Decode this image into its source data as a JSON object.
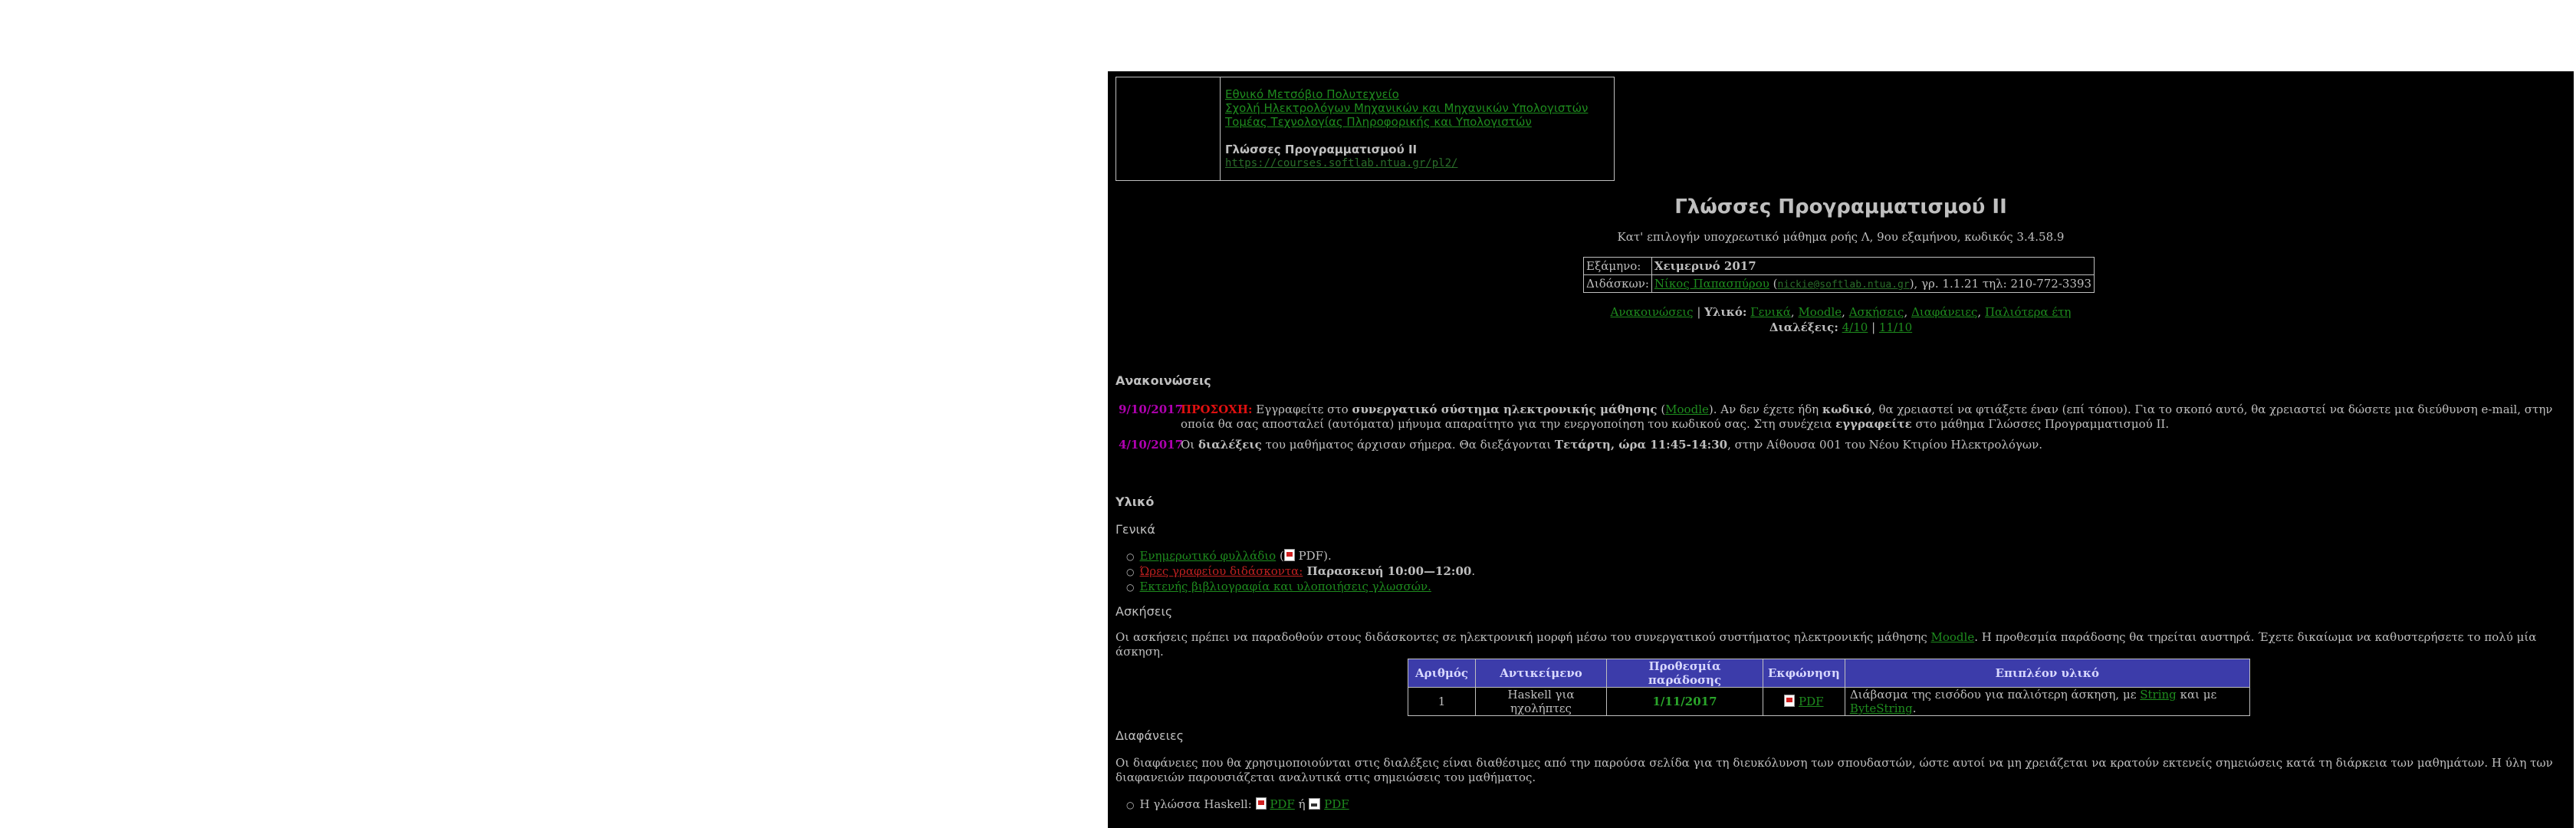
{
  "header": {
    "links": [
      "Εθνικό Μετσόβιο Πολυτεχνείο",
      "Σχολή Ηλεκτρολόγων Μηχανικών και Μηχανικών Υπολογιστών",
      "Τομέας Τεχνολογίας Πληροφορικής και Υπολογιστών"
    ],
    "course_name": "Γλώσσες Προγραμματισμού ΙΙ",
    "course_url": "https://courses.softlab.ntua.gr/pl2/"
  },
  "course": {
    "title": "Γλώσσες Προγραμματισμού ΙΙ",
    "subtitle": "Κατ' επιλογήν υποχρεωτικό μάθημα ροής Λ, 9ου εξαμήνου, κωδικός 3.4.58.9"
  },
  "info": {
    "semester_label": "Εξάμηνο:",
    "semester_value": "Χειμερινό 2017",
    "instructor_label": "Διδάσκων:",
    "instructor_name": "Νίκος Παπασπύρου",
    "instructor_email": "nickie@softlab.ntua.gr",
    "instructor_open": "(",
    "instructor_rest": "), γρ. 1.1.21 τηλ: 210-772-3393"
  },
  "nav": {
    "announcements": "Ανακοινώσεις",
    "sep": " | ",
    "material_label": "Υλικό:",
    "items": [
      "Γενικά",
      "Moodle",
      "Ασκήσεις",
      "Διαφάνειες",
      "Παλιότερα έτη"
    ],
    "lectures_label": "Διαλέξεις:",
    "lectures": [
      "4/10",
      "11/10"
    ],
    "pipe": " | "
  },
  "announcements": {
    "heading": "Ανακοινώσεις",
    "items": [
      {
        "date": "9/10/2017",
        "warn": "ΠΡΟΣΟΧΗ:",
        "t1": " Εγγραφείτε στο ",
        "b1": "συνεργατικό σύστημα ηλεκτρονικής μάθησης",
        "t2": " (",
        "link": "Moodle",
        "t3": "). Αν δεν έχετε ήδη ",
        "b2": "κωδικό",
        "t4": ", θα χρειαστεί να φτιάξετε έναν (επί τόπου). Για το σκοπό αυτό, θα χρειαστεί να δώσετε μια διεύθυνση e-mail, στην οποία θα σας αποσταλεί (αυτόματα) μήνυμα απαραίτητο για την ενεργοποίηση του κωδικού σας. Στη συνέχεια ",
        "b3": "εγγραφείτε",
        "t5": " στο μάθημα Γλώσσες Προγραμματισμού ΙΙ."
      },
      {
        "date": "4/10/2017",
        "t1": "Οι ",
        "b1": "διαλέξεις",
        "t2": " του μαθήματος άρχισαν σήμερα. Θα διεξάγονται ",
        "b2": "Τετάρτη, ώρα 11:45-14:30",
        "t3": ", στην Αίθουσα 001 του Νέου Κτιρίου Ηλεκτρολόγων."
      }
    ]
  },
  "material": {
    "heading": "Υλικό",
    "general_heading": "Γενικά",
    "general": {
      "info_link": "Ενημερωτικό φυλλάδιο",
      "info_open": " (",
      "info_pdf": " PDF).",
      "hours_link": "Ώρες γραφείου διδάσκοντα:",
      "hours_value": " Παρασκευή 10:00—12:00",
      "hours_end": ".",
      "biblio_link": "Εκτενής βιβλιογραφία και υλοποιήσεις γλωσσών."
    },
    "exercises_heading": "Ασκήσεις",
    "exercises_text": "Οι ασκήσεις πρέπει να παραδοθούν στους διδάσκοντες σε ηλεκτρονική μορφή μέσω του συνεργατικού συστήματος ηλεκτρονικής μάθησης ",
    "exercises_link": "Moodle",
    "exercises_text2": ". Η προθεσμία παράδοσης θα τηρείται αυστηρά. Έχετε δικαίωμα να καθυστερήσετε το πολύ μία άσκηση.",
    "table": {
      "headers": [
        "Αριθμός",
        "Αντικείμενο",
        "Προθεσμία παράδοσης",
        "Εκφώνηση",
        "Επιπλέον υλικό"
      ],
      "row": {
        "num": "1",
        "subject": "Haskell για ηχολήπτες",
        "due": "1/11/2017",
        "pdf": "PDF",
        "extra1": "Διάβασμα της εισόδου για παλιότερη άσκηση, με ",
        "extra_link1": "String",
        "extra2": " και με ",
        "extra_link2": "ByteString",
        "extra3": "."
      }
    },
    "slides_heading": "Διαφάνειες",
    "slides_text": "Οι διαφάνειες που θα χρησιμοποιούνται στις διαλέξεις είναι διαθέσιμες από την παρούσα σελίδα για τη διευκόλυνση των σπουδαστών, ώστε αυτοί να μη χρειάζεται να κρατούν εκτενείς σημειώσεις κατά τη διάρκεια των μαθημάτων. Η ύλη των διαφανειών παρουσιάζεται αναλυτικά στις σημειώσεις του μαθήματος.",
    "slides_item": "Η γλώσσα Haskell:",
    "slides_pdf1": "PDF",
    "slides_or": " ή ",
    "slides_pdf2": "PDF"
  }
}
